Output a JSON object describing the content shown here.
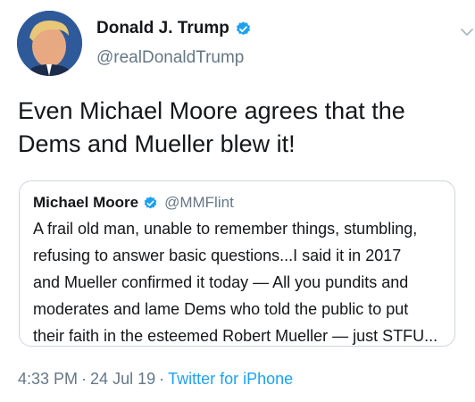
{
  "author": {
    "display_name": "Donald J. Trump",
    "handle": "@realDonaldTrump",
    "avatar_icon": "profile-photo",
    "verified_icon": "verified-badge-icon"
  },
  "tweet": {
    "text": "Even Michael Moore agrees that the\nDems and Mueller blew it!"
  },
  "quoted_tweet": {
    "display_name": "Michael Moore",
    "handle": "@MMFlint",
    "verified_icon": "verified-badge-icon",
    "text": "A frail old man, unable to remember things, stumbling,\nrefusing to answer basic questions...I said it in 2017\nand Mueller confirmed it today — All you pundits and\nmoderates and lame Dems who told the public to put\ntheir faith in the esteemed Robert Mueller — just STFU..."
  },
  "meta": {
    "time": "4:33 PM",
    "separator": "·",
    "date": "24 Jul 19",
    "source": "Twitter for iPhone"
  },
  "colors": {
    "text": "#14171a",
    "secondary": "#657786",
    "accent": "#1da1f2",
    "border": "#ccd6dd"
  }
}
